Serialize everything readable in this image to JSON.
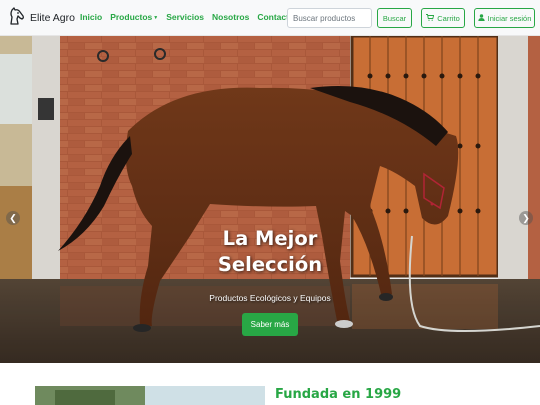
{
  "brand": {
    "name": "Elite Agro",
    "logo_icon": "horse-head-icon"
  },
  "nav": {
    "items": [
      {
        "label": "Inicio",
        "has_dropdown": false
      },
      {
        "label": "Productos",
        "has_dropdown": true
      },
      {
        "label": "Servicios",
        "has_dropdown": false
      },
      {
        "label": "Nosotros",
        "has_dropdown": false
      },
      {
        "label": "Contacto",
        "has_dropdown": false
      }
    ],
    "search_placeholder": "Buscar productos",
    "search_button": "Buscar",
    "cart_button": "Carrito",
    "login_button": "Iniciar sesión",
    "accent_color": "#28a745"
  },
  "hero": {
    "title": "La Mejor Selección",
    "subtitle": "Productos Ecológicos y Equipos",
    "cta": "Saber más"
  },
  "about": {
    "title": "Fundada en 1999"
  }
}
